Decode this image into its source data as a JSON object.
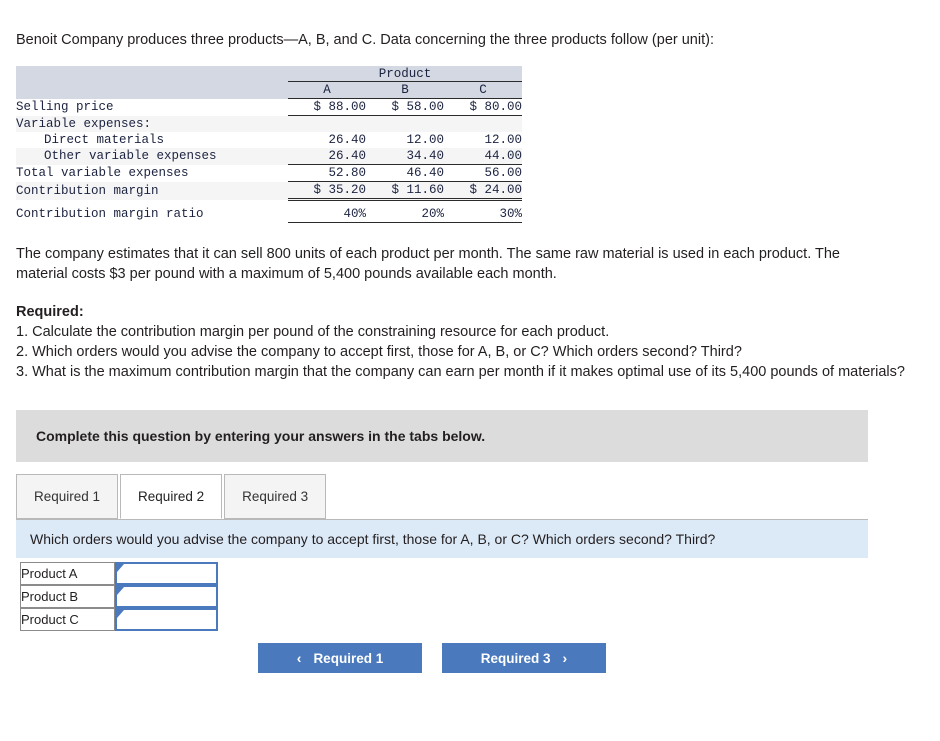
{
  "intro": {
    "text": "Benoit Company produces three products—A, B, and C. Data concerning the three products follow (per unit):"
  },
  "data_table": {
    "group_header": "Product",
    "columns": [
      "A",
      "B",
      "C"
    ],
    "rows": [
      {
        "label": "Selling price",
        "indent": false,
        "values": [
          "$ 88.00",
          "$ 58.00",
          "$ 80.00"
        ]
      },
      {
        "label": "Variable expenses:",
        "indent": false,
        "values": [
          "",
          "",
          ""
        ]
      },
      {
        "label": "Direct materials",
        "indent": true,
        "values": [
          "26.40",
          "12.00",
          "12.00"
        ]
      },
      {
        "label": "Other variable expenses",
        "indent": true,
        "values": [
          "26.40",
          "34.40",
          "44.00"
        ]
      },
      {
        "label": "Total variable expenses",
        "indent": false,
        "values": [
          "52.80",
          "46.40",
          "56.00"
        ]
      },
      {
        "label": "Contribution margin",
        "indent": false,
        "values": [
          "$ 35.20",
          "$ 11.60",
          "$ 24.00"
        ]
      },
      {
        "label": "Contribution margin ratio",
        "indent": false,
        "values": [
          "40%",
          "20%",
          "30%"
        ]
      }
    ]
  },
  "estimate_paragraph": {
    "line1": "The company estimates that it can sell 800 units of each product per month. The same raw material is used in each product. The",
    "line2": "material costs $3 per pound with a maximum of 5,400 pounds available each month."
  },
  "required": {
    "heading": "Required:",
    "items": [
      "1. Calculate the contribution margin per pound of the constraining resource for each product.",
      "2. Which orders would you advise the company to accept first, those for A, B, or C? Which orders second? Third?",
      "3. What is the maximum contribution margin that the company can earn per month if it makes optimal use of its 5,400 pounds of materials?"
    ]
  },
  "instruction_banner": {
    "text": "Complete this question by entering your answers in the tabs below."
  },
  "tabs": [
    {
      "label": "Required 1",
      "active": false
    },
    {
      "label": "Required 2",
      "active": true
    },
    {
      "label": "Required 3",
      "active": false
    }
  ],
  "question_bar": {
    "text": "Which orders would you advise the company to accept first, those for A, B, or C? Which orders second? Third?"
  },
  "answer_table": {
    "rows": [
      {
        "label": "Product A",
        "value": "",
        "placeholder": ""
      },
      {
        "label": "Product B",
        "value": "",
        "placeholder": ""
      },
      {
        "label": "Product C",
        "value": "",
        "placeholder": ""
      }
    ]
  },
  "nav": {
    "prev_label": "Required 1",
    "prev_chevron": "‹",
    "next_label": "Required 3",
    "next_chevron": "›"
  },
  "colors": {
    "accent_blue": "#4a79bd",
    "question_bar_bg": "#dce9f7",
    "banner_gray": "#dcdcdc",
    "table_header_gray": "#d3d8e2",
    "row_stripe": "#f5f5f5"
  }
}
